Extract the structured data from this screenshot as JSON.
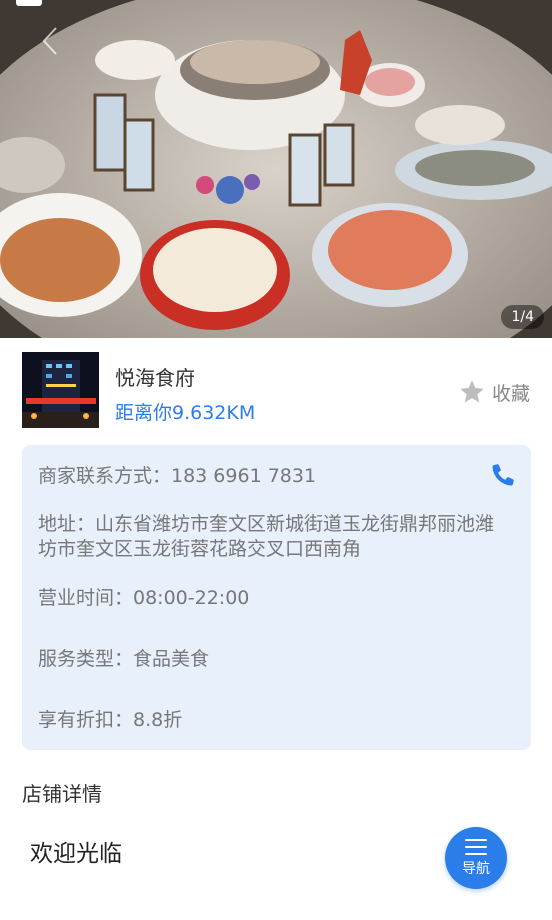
{
  "gallery": {
    "pager": "1/4"
  },
  "shop": {
    "name": "悦海食府",
    "distance": "距离你9.632KM",
    "favorite_label": "收藏",
    "thumb_sign": "悦海食府"
  },
  "info": {
    "phone": "商家联系方式：183 6961 7831",
    "address": "地址：山东省潍坊市奎文区新城街道玉龙街鼎邦丽池潍坊市奎文区玉龙街蓉花路交叉口西南角",
    "hours": "营业时间：08:00-22:00",
    "service": "服务类型：食品美食",
    "discount": "享有折扣：8.8折"
  },
  "details": {
    "title": "店铺详情",
    "welcome": "欢迎光临"
  },
  "nav_button": {
    "label": "导航"
  },
  "colors": {
    "accent": "#2b7de9",
    "card_bg": "#e8f0fc"
  }
}
